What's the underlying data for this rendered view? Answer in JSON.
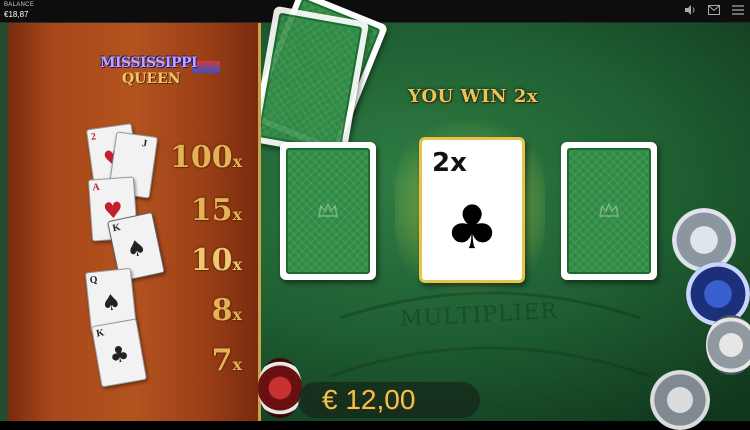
{
  "header": {
    "balance_label": "BALANCE",
    "balance_value": "€18,87",
    "icons": [
      "speaker-icon",
      "mail-icon",
      "menu-icon"
    ]
  },
  "logo": {
    "line1": "MISSISSIPPI",
    "line2": "QUEEN"
  },
  "ladder": [
    {
      "value": "100",
      "suffix": "x"
    },
    {
      "value": "15",
      "suffix": "x"
    },
    {
      "value": "10",
      "suffix": "x"
    },
    {
      "value": "8",
      "suffix": "x"
    },
    {
      "value": "7",
      "suffix": "x"
    }
  ],
  "mini_cards": [
    {
      "rank": "2",
      "suit": "♥",
      "color": "#c0232b"
    },
    {
      "rank": "A",
      "suit": "♥",
      "color": "#c0232b"
    },
    {
      "rank": "K",
      "suit": "♠",
      "color": "#222"
    },
    {
      "rank": "Q",
      "suit": "♠",
      "color": "#222"
    },
    {
      "rank": "K",
      "suit": "♣",
      "color": "#222"
    }
  ],
  "result": {
    "banner": "YOU WIN 2x",
    "revealed_multiplier": "2x",
    "revealed_suit": "♣"
  },
  "table_print": "MULTIPLIER",
  "win_amount": "€ 12,00",
  "colors": {
    "felt": "#2f7d44",
    "gold": "#e3b255",
    "wood": "#a8481b"
  }
}
